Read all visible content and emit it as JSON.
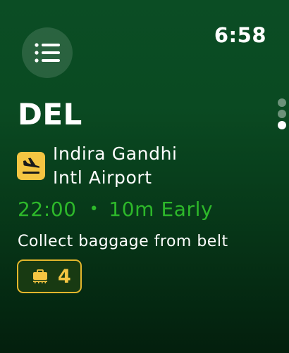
{
  "status_bar": {
    "time": "6:58"
  },
  "menu": {
    "icon": "list-icon"
  },
  "pagination": {
    "pages": 3,
    "active_index": 2
  },
  "flight": {
    "airport_code": "DEL",
    "status_icon": "plane-arrival-icon",
    "airport_name_line1": "Indira Gandhi",
    "airport_name_line2": "Intl Airport",
    "arrival_time": "22:00",
    "separator": "•",
    "status": "10m Early",
    "instruction": "Collect baggage from belt",
    "baggage_belt_icon": "luggage-icon",
    "baggage_belt": "4"
  },
  "colors": {
    "background_top": "#0b4d24",
    "background_bottom": "#031f0d",
    "accent_green": "#2db82a",
    "accent_yellow": "#f4c542"
  }
}
